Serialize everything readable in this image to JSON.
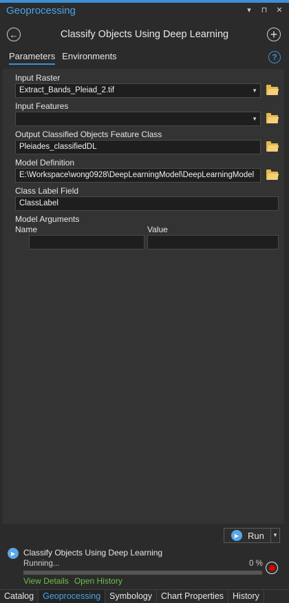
{
  "pane": {
    "title": "Geoprocessing",
    "controls": [
      "▾",
      "⊓",
      "✕"
    ]
  },
  "tool": {
    "title": "Classify Objects Using Deep Learning",
    "back_icon": "back-arrow-icon",
    "add_icon": "add-icon"
  },
  "tabs": [
    {
      "label": "Parameters",
      "active": true
    },
    {
      "label": "Environments",
      "active": false
    }
  ],
  "help_icon": "?",
  "params": {
    "input_raster": {
      "label": "Input Raster",
      "value": "Extract_Bands_Pleiad_2.tif"
    },
    "input_features": {
      "label": "Input Features",
      "value": ""
    },
    "output_class": {
      "label": "Output Classified Objects Feature Class",
      "value": "Pleiades_classifiedDL"
    },
    "model_definition": {
      "label": "Model Definition",
      "value": "E:\\Workspace\\wong0928\\DeepLearningModel\\DeepLearningModel"
    },
    "class_label_field": {
      "label": "Class Label Field",
      "value": "ClassLabel"
    },
    "model_arguments": {
      "label": "Model Arguments",
      "col_name": "Name",
      "col_value": "Value",
      "row": {
        "name": "",
        "value": ""
      }
    }
  },
  "run": {
    "label": "Run"
  },
  "status": {
    "title": "Classify Objects Using Deep Learning",
    "text": "Running...",
    "percent_label": "0 %",
    "progress": 0,
    "view_details": "View Details",
    "open_history": "Open History"
  },
  "bottom_tabs": [
    {
      "label": "Catalog",
      "active": false
    },
    {
      "label": "Geoprocessing",
      "active": true
    },
    {
      "label": "Symbology",
      "active": false
    },
    {
      "label": "Chart Properties",
      "active": false
    },
    {
      "label": "History",
      "active": false
    }
  ],
  "colors": {
    "accent": "#3d8fd6",
    "link": "#6cc04a",
    "stop": "#e00000",
    "folder": "#e8b84a"
  }
}
